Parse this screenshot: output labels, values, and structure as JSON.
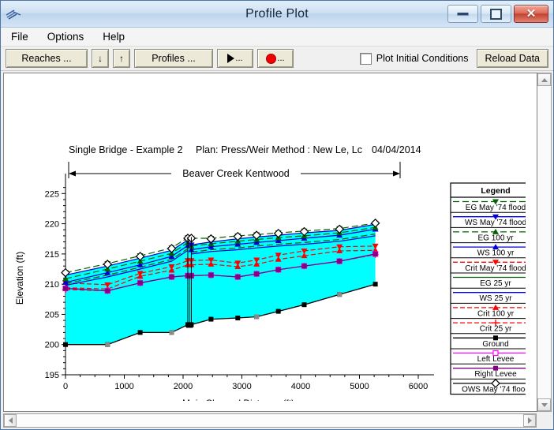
{
  "window": {
    "title": "Profile Plot",
    "icon": "profile-plot-icon",
    "minimize_label": "–",
    "maximize_label": "□",
    "close_label": "✕"
  },
  "menu": {
    "items": [
      {
        "label": "File"
      },
      {
        "label": "Options"
      },
      {
        "label": "Help"
      }
    ]
  },
  "toolbar": {
    "reaches_label": "Reaches ...",
    "down_arrow_label": "↓",
    "up_arrow_label": "↑",
    "profiles_label": "Profiles ...",
    "play_label": "",
    "play_dots": "...",
    "record_label": "",
    "record_dots": "...",
    "plot_initial_conditions_label": "Plot Initial Conditions",
    "plot_initial_conditions_checked": false,
    "reload_label": "Reload Data"
  },
  "scrollbars": {
    "v_up": "▲",
    "v_down": "▼",
    "h_left": "◀",
    "h_right": "▶"
  },
  "chart_data": {
    "type": "line",
    "title_left": "Single Bridge - Example 2",
    "title_center": "Plan: Press/Weir Method : New Le, Lc",
    "title_date": "04/04/2014",
    "reach_label": "Beaver Creek Kentwood",
    "xlabel": "Main Channel Distance (ft)",
    "ylabel": "Elevation (ft)",
    "xlim": [
      0,
      6000
    ],
    "ylim": [
      195,
      227
    ],
    "xticks": [
      0,
      1000,
      2000,
      3000,
      4000,
      5000,
      6000
    ],
    "yticks": [
      195,
      200,
      205,
      210,
      215,
      220,
      225
    ],
    "y_minor_ticks": [
      196,
      197,
      198,
      199,
      201,
      202,
      203,
      204,
      206,
      207,
      208,
      209,
      211,
      212,
      213,
      214,
      216,
      217,
      218,
      219,
      221,
      222,
      223,
      224,
      226
    ],
    "grid": false,
    "legend_position": "right",
    "legend_title": "Legend",
    "fill_color": "#00ffff",
    "x": [
      0,
      715,
      1270,
      1805,
      2080,
      2110,
      2140,
      2475,
      2930,
      3250,
      3620,
      4060,
      4660,
      5270
    ],
    "series": [
      {
        "name": "OWS  May '74 flood",
        "key": "ows_may74",
        "color": "#000000",
        "marker": "diamond-open",
        "dash": "none",
        "line": "none",
        "values": [
          211.9,
          213.3,
          214.6,
          215.9,
          217.6,
          null,
          217.6,
          217.5,
          217.9,
          218.1,
          218.4,
          218.7,
          219.1,
          220.1
        ]
      },
      {
        "name": "EG  May '74 flood",
        "key": "eg_may74",
        "color": "#006400",
        "marker": "triangle-down",
        "dash": "8,4",
        "values": [
          211.9,
          213.4,
          214.7,
          216.0,
          217.7,
          null,
          217.6,
          217.6,
          218.0,
          218.2,
          218.5,
          218.8,
          219.2,
          220.1
        ]
      },
      {
        "name": "WS  May '74 flood",
        "key": "ws_may74",
        "color": "#0000cd",
        "marker": "triangle-down",
        "dash": "none",
        "values": [
          211.5,
          213.0,
          214.3,
          215.6,
          217.3,
          null,
          216.5,
          217.0,
          217.5,
          217.8,
          218.1,
          218.5,
          218.9,
          219.9
        ]
      },
      {
        "name": "EG  100 yr",
        "key": "eg_100",
        "color": "#006400",
        "marker": "triangle-up",
        "dash": "8,4",
        "values": [
          210.9,
          212.5,
          213.8,
          215.1,
          216.9,
          null,
          216.3,
          216.7,
          217.1,
          217.4,
          217.7,
          218.0,
          218.5,
          219.4
        ]
      },
      {
        "name": "WS  100 yr",
        "key": "ws_100",
        "color": "#0000cd",
        "marker": "triangle-up",
        "dash": "none",
        "values": [
          210.3,
          211.9,
          213.2,
          214.6,
          216.4,
          null,
          215.7,
          216.2,
          216.6,
          216.9,
          217.2,
          217.6,
          218.1,
          219.1
        ]
      },
      {
        "name": "Crit  May '74 flood",
        "key": "crit_may74",
        "color": "#ff0000",
        "marker": "triangle-down",
        "dash": "6,3",
        "values": [
          210.2,
          209.9,
          211.8,
          212.9,
          213.9,
          null,
          213.9,
          214.0,
          213.5,
          214.0,
          214.8,
          215.5,
          216.2,
          216.3
        ]
      },
      {
        "name": "EG  25 yr",
        "key": "eg_25",
        "color": "#006400",
        "marker": "none",
        "dash": "8,4",
        "values": [
          210.1,
          211.5,
          212.8,
          214.1,
          215.9,
          null,
          215.3,
          215.7,
          216.0,
          216.3,
          216.6,
          216.9,
          217.4,
          218.3
        ]
      },
      {
        "name": "WS  25 yr",
        "key": "ws_25",
        "color": "#0000cd",
        "marker": "none",
        "dash": "none",
        "values": [
          209.8,
          211.2,
          212.5,
          213.8,
          215.6,
          null,
          215.0,
          215.4,
          215.7,
          216.0,
          216.3,
          216.6,
          217.1,
          218.0
        ]
      },
      {
        "name": "Crit  100 yr",
        "key": "crit_100",
        "color": "#ff0000",
        "marker": "triangle-up",
        "dash": "6,3",
        "values": [
          209.4,
          209.2,
          211.3,
          212.3,
          213.2,
          null,
          213.2,
          213.3,
          212.9,
          213.3,
          214.1,
          214.7,
          215.5,
          215.6
        ]
      },
      {
        "name": "Crit  25 yr",
        "key": "crit_25",
        "color": "#ff0000",
        "marker": "plus",
        "dash": "6,3",
        "values": [
          209.1,
          208.9,
          210.2,
          211.2,
          211.4,
          null,
          211.4,
          211.5,
          211.2,
          211.7,
          212.4,
          213.0,
          213.8,
          214.9
        ]
      },
      {
        "name": "Ground",
        "key": "ground",
        "color": "#000000",
        "marker": "square",
        "dash": "none",
        "values": [
          200.0,
          200.0,
          202.0,
          202.0,
          203.3,
          203.3,
          203.3,
          204.2,
          204.4,
          204.6,
          205.5,
          206.6,
          208.3,
          210.0
        ]
      },
      {
        "name": "Left Levee",
        "key": "left_levee",
        "color": "#ff00ff",
        "marker": "square-open",
        "dash": "none",
        "values": [
          209.3,
          208.9,
          210.2,
          211.2,
          211.4,
          null,
          211.4,
          211.5,
          211.2,
          211.7,
          212.4,
          213.0,
          213.8,
          215.0
        ]
      },
      {
        "name": "Right Levee",
        "key": "right_levee",
        "color": "#800080",
        "marker": "square",
        "dash": "none",
        "values": [
          209.3,
          208.9,
          210.2,
          211.2,
          211.4,
          null,
          211.4,
          211.5,
          211.2,
          211.7,
          212.4,
          213.0,
          213.8,
          215.0
        ]
      }
    ],
    "legend_entries": [
      {
        "label": "EG  May '74 flood",
        "color": "#006400",
        "dash": "8,4",
        "marker": "triangle-down"
      },
      {
        "label": "WS  May '74 flood",
        "color": "#0000cd",
        "dash": "none",
        "marker": "triangle-down"
      },
      {
        "label": "EG  100 yr",
        "color": "#006400",
        "dash": "8,4",
        "marker": "triangle-up"
      },
      {
        "label": "WS  100 yr",
        "color": "#0000cd",
        "dash": "none",
        "marker": "triangle-up"
      },
      {
        "label": "Crit  May '74 flood",
        "color": "#ff0000",
        "dash": "6,3",
        "marker": "triangle-down"
      },
      {
        "label": "EG  25 yr",
        "color": "#006400",
        "dash": "none",
        "marker": "none"
      },
      {
        "label": "WS  25 yr",
        "color": "#0000cd",
        "dash": "none",
        "marker": "none"
      },
      {
        "label": "Crit  100 yr",
        "color": "#ff0000",
        "dash": "6,3",
        "marker": "triangle-up"
      },
      {
        "label": "Crit  25 yr",
        "color": "#ff0000",
        "dash": "6,3",
        "marker": "plus"
      },
      {
        "label": "Ground",
        "color": "#000000",
        "dash": "none",
        "marker": "square"
      },
      {
        "label": "Left Levee",
        "color": "#ff00ff",
        "dash": "none",
        "marker": "square-open"
      },
      {
        "label": "Right Levee",
        "color": "#800080",
        "dash": "none",
        "marker": "square"
      },
      {
        "label": "OWS  May '74 flood",
        "color": "#000000",
        "dash": "none",
        "marker": "diamond-open"
      }
    ],
    "bridge": {
      "x_upstream": 2080,
      "x_downstream": 2140,
      "top": 217.8,
      "bottom": 203.3
    }
  }
}
